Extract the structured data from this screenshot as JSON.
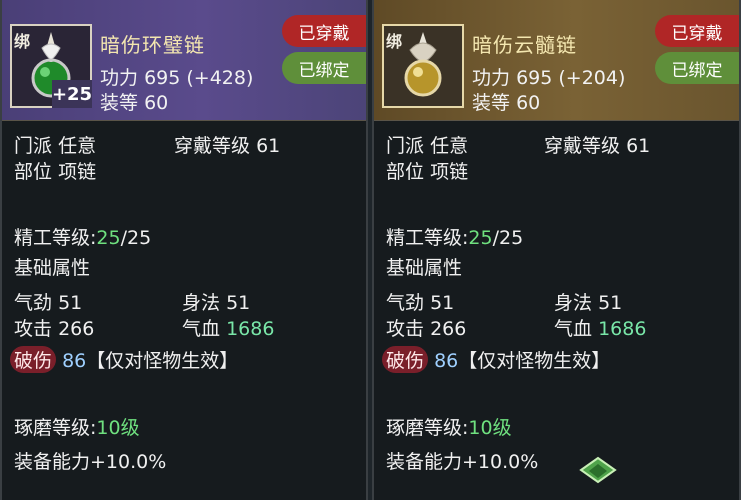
{
  "colors": {
    "panel_bg": "#161b1e",
    "header_purple": "#5a4b8c",
    "header_gold": "#7a6235",
    "tag_red": "#b02626",
    "tag_green": "#5f8f3a",
    "accent_green": "#6fe07f"
  },
  "cards": [
    {
      "icon": "green-jade-pendant-icon",
      "bind_label": "绑",
      "enhance": "+25",
      "name": "暗伤环璧链",
      "power_label": "功力",
      "power_value": "695",
      "power_bonus": "(+428)",
      "level_label": "装等",
      "level_value": "60",
      "equip_tag": "已穿戴",
      "bound_tag": "已绑定",
      "sect_label": "门派",
      "sect_value": "任意",
      "wear_level_label": "穿戴等级",
      "wear_level_value": "61",
      "slot_label": "部位",
      "slot_value": "项链",
      "craft_label": "精工等级:",
      "craft_current": "25",
      "craft_max": "/25",
      "base_attr_title": "基础属性",
      "qi_label": "气劲",
      "qi_value": "51",
      "agility_label": "身法",
      "agility_value": "51",
      "attack_label": "攻击",
      "attack_value": "266",
      "hp_label": "气血",
      "hp_value": "1686",
      "pierce_label": "破伤",
      "pierce_value": "86",
      "pierce_note": "【仅对怪物生效】",
      "polish_label": "琢磨等级:",
      "polish_value": "10级",
      "equip_ability_label": "装备能力",
      "equip_ability_value": "+10.0%"
    },
    {
      "icon": "gold-amber-pendant-icon",
      "bind_label": "绑",
      "name": "暗伤云髓链",
      "power_label": "功力",
      "power_value": "695",
      "power_bonus": "(+204)",
      "level_label": "装等",
      "level_value": "60",
      "equip_tag": "已穿戴",
      "bound_tag": "已绑定",
      "sect_label": "门派",
      "sect_value": "任意",
      "wear_level_label": "穿戴等级",
      "wear_level_value": "61",
      "slot_label": "部位",
      "slot_value": "项链",
      "craft_label": "精工等级:",
      "craft_current": "25",
      "craft_max": "/25",
      "base_attr_title": "基础属性",
      "qi_label": "气劲",
      "qi_value": "51",
      "agility_label": "身法",
      "agility_value": "51",
      "attack_label": "攻击",
      "attack_value": "266",
      "hp_label": "气血",
      "hp_value": "1686",
      "pierce_label": "破伤",
      "pierce_value": "86",
      "pierce_note": "【仅对怪物生效】",
      "polish_label": "琢磨等级:",
      "polish_value": "10级",
      "equip_ability_label": "装备能力",
      "equip_ability_value": "+10.0%"
    }
  ],
  "footer_logo": "green-game-logo-icon"
}
